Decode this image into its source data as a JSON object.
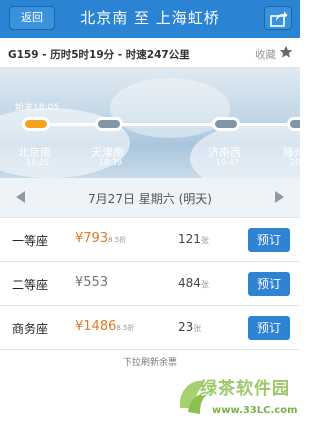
{
  "header": {
    "back_label": "返回",
    "title": "北京南 至 上海虹桥",
    "share_icon": "share-icon"
  },
  "train_info": {
    "text": "G159 - 历时5时19分 - 时速247公里",
    "favorite_label": "收藏",
    "favorite_icon": "star-icon"
  },
  "route": {
    "depart_label": "始发18:05",
    "stations": [
      {
        "name": "北京南",
        "time": "18:05",
        "origin": true
      },
      {
        "name": "天津南",
        "time": "18:39",
        "origin": false
      },
      {
        "name": "济南西",
        "time": "19:47",
        "origin": false
      },
      {
        "name": "滕州",
        "time": "20:",
        "origin": false
      }
    ],
    "origin_color": "#f7a21b"
  },
  "date_bar": {
    "date": "7月27日 星期六 (明天)"
  },
  "seats": [
    {
      "name": "一等座",
      "price": "¥793",
      "discount": "8.5折",
      "count": "121",
      "unit": "张",
      "button": "预订"
    },
    {
      "name": "二等座",
      "price": "¥553",
      "discount": "",
      "count": "484",
      "unit": "张",
      "button": "预订"
    },
    {
      "name": "商务座",
      "price": "¥1486",
      "discount": "8.5折",
      "count": "23",
      "unit": "张",
      "button": "预订"
    }
  ],
  "pull_hint": "下拉刷新余票",
  "watermark": {
    "name": "绿茶软件园",
    "url": "www.33LC.com"
  },
  "colors": {
    "header_bg": "#2b84d3",
    "price": "#e07a24",
    "button": "#2e84d2"
  }
}
